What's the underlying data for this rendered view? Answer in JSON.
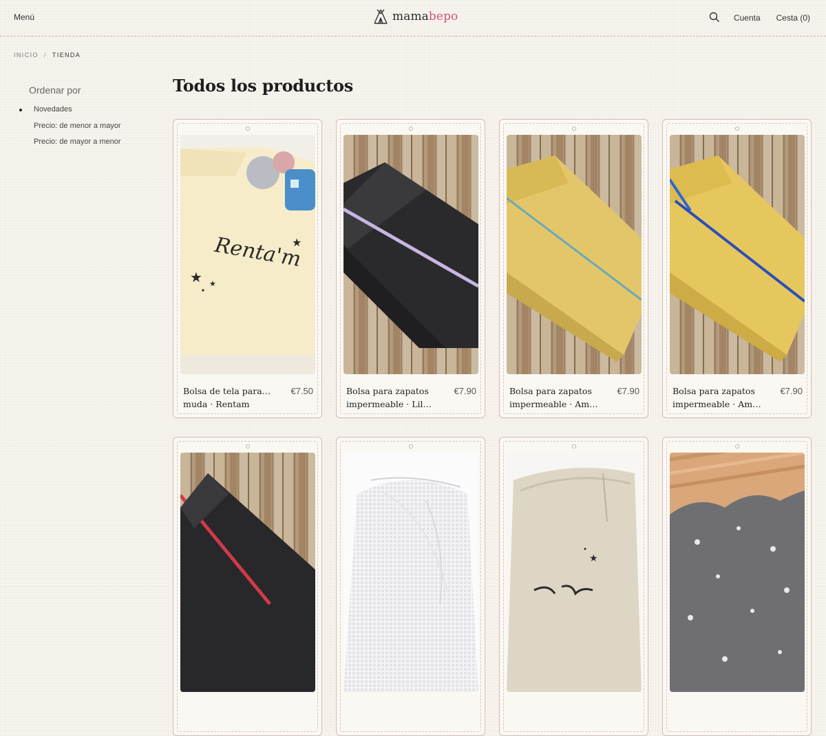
{
  "header": {
    "menu_label": "Menú",
    "logo_part1": "mama",
    "logo_part2": "bepo",
    "account_label": "Cuenta",
    "cart_label": "Cesta (0)",
    "brand_pink": "#d2537b"
  },
  "breadcrumb": {
    "home": "INICIO",
    "separator": "/",
    "current": "TIENDA"
  },
  "sort": {
    "title": "Ordenar por",
    "options": [
      {
        "label": "Novedades",
        "selected": true
      },
      {
        "label": "Precio: de menor a mayor",
        "selected": false
      },
      {
        "label": "Precio: de mayor a menor",
        "selected": false
      }
    ]
  },
  "main": {
    "title": "Todos los productos"
  },
  "products": [
    {
      "name_line1": "Bolsa de tela para la",
      "name_line2": "muda · Rentam",
      "price": "€7.50",
      "image_text": "Renta'm"
    },
    {
      "name_line1": "Bolsa para zapatos",
      "name_line2": "impermeable · Lila...",
      "price": "€7.90"
    },
    {
      "name_line1": "Bolsa para zapatos",
      "name_line2": "impermeable · Amaril...",
      "price": "€7.90"
    },
    {
      "name_line1": "Bolsa para zapatos",
      "name_line2": "impermeable · Amaril...",
      "price": "€7.90"
    },
    {
      "name_line1": "",
      "name_line2": "",
      "price": ""
    },
    {
      "name_line1": "",
      "name_line2": "",
      "price": ""
    },
    {
      "name_line1": "",
      "name_line2": "",
      "price": ""
    },
    {
      "name_line1": "",
      "name_line2": "",
      "price": ""
    }
  ]
}
